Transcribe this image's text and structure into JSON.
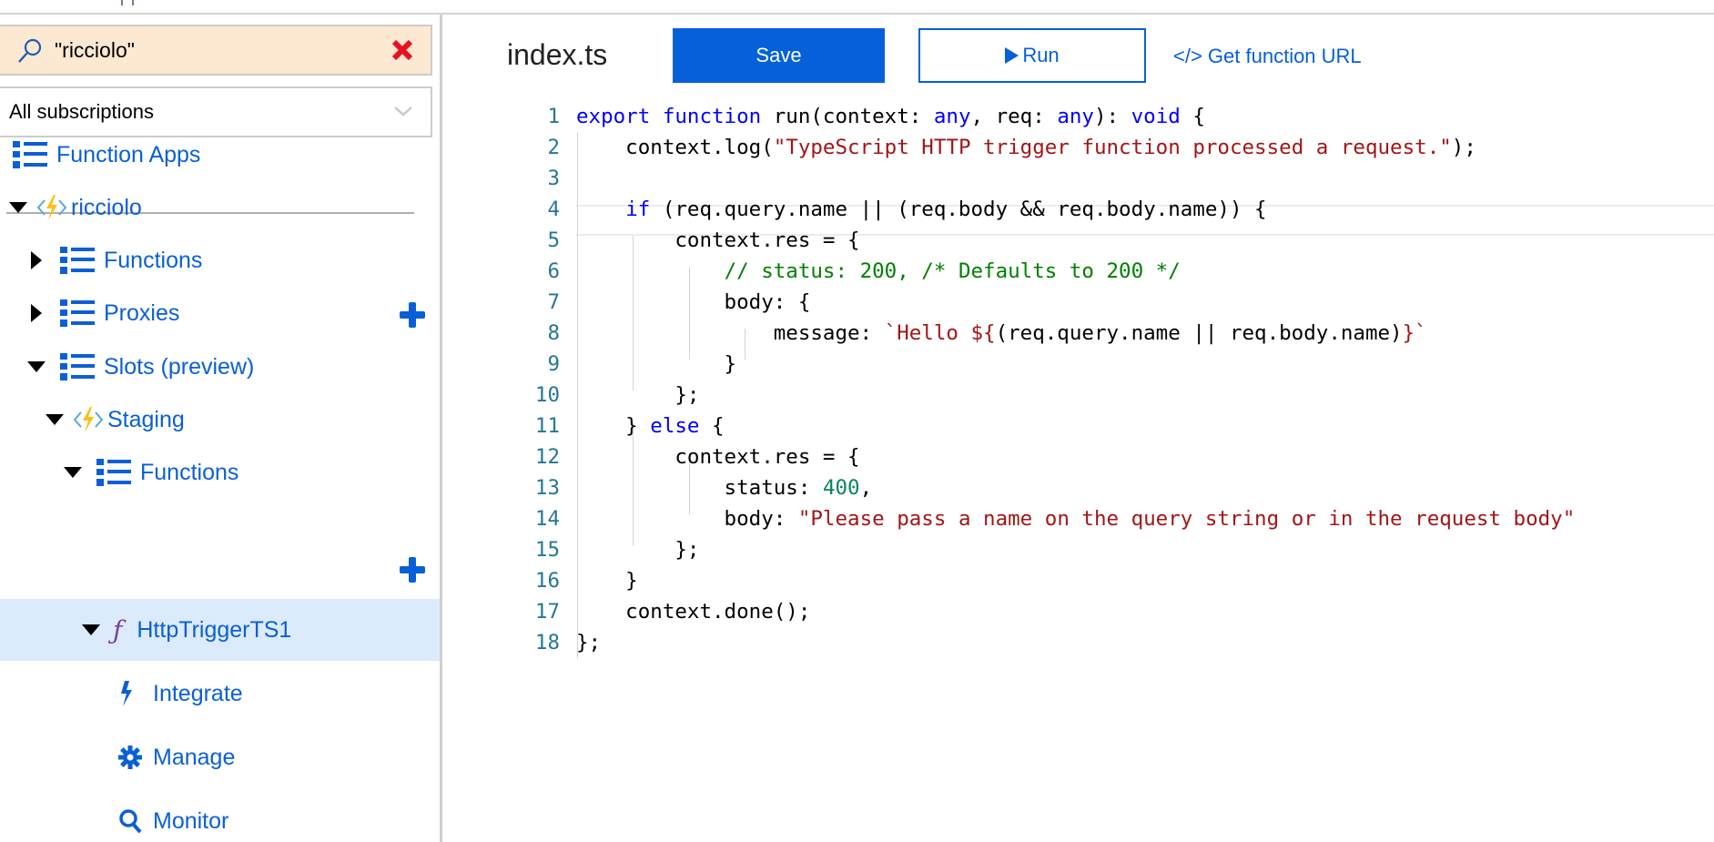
{
  "sidebar": {
    "search": {
      "value": "\"ricciolo\"",
      "placeholder": ""
    },
    "subscription_filter": "All subscriptions",
    "root_label": "Function Apps",
    "tree": [
      {
        "label": "ricciolo",
        "icon": "function-app-icon",
        "expanded": true
      },
      {
        "label": "Functions",
        "icon": "list-icon",
        "expanded": false,
        "add": true
      },
      {
        "label": "Proxies",
        "icon": "list-icon",
        "expanded": false
      },
      {
        "label": "Slots (preview)",
        "icon": "list-icon",
        "expanded": true
      },
      {
        "label": "Staging",
        "icon": "function-app-icon",
        "expanded": true
      },
      {
        "label": "Functions",
        "icon": "list-icon",
        "expanded": true,
        "add": true
      },
      {
        "label": "HttpTriggerTS1",
        "icon": "function-icon",
        "expanded": true,
        "selected": true
      },
      {
        "label": "Integrate",
        "icon": "lightning-icon"
      },
      {
        "label": "Manage",
        "icon": "gear-icon"
      },
      {
        "label": "Monitor",
        "icon": "search-icon"
      }
    ]
  },
  "toolbar": {
    "file_name": "index.ts",
    "save_label": "Save",
    "run_label": "Run",
    "url_label": "</> Get function URL"
  },
  "editor": {
    "current_line": 4,
    "lines": [
      "export function run(context: any, req: any): void {",
      "    context.log(\"TypeScript HTTP trigger function processed a request.\");",
      "",
      "    if (req.query.name || (req.body && req.body.name)) {",
      "        context.res = {",
      "            // status: 200, /* Defaults to 200 */",
      "            body: {",
      "                message: `Hello ${(req.query.name || req.body.name)}`",
      "            }",
      "        };",
      "    } else {",
      "        context.res = {",
      "            status: 400,",
      "            body: \"Please pass a name on the query string or in the request body\"",
      "        };",
      "    }",
      "    context.done();",
      "};"
    ]
  },
  "colors": {
    "accent": "#0560d9",
    "search_bg": "#fde8d1",
    "selected_row": "#dcebfb",
    "keyword": "#0000ff",
    "string": "#a31515",
    "comment": "#008000",
    "number": "#098658",
    "line_number": "#237893",
    "clear_icon": "#e81123"
  }
}
